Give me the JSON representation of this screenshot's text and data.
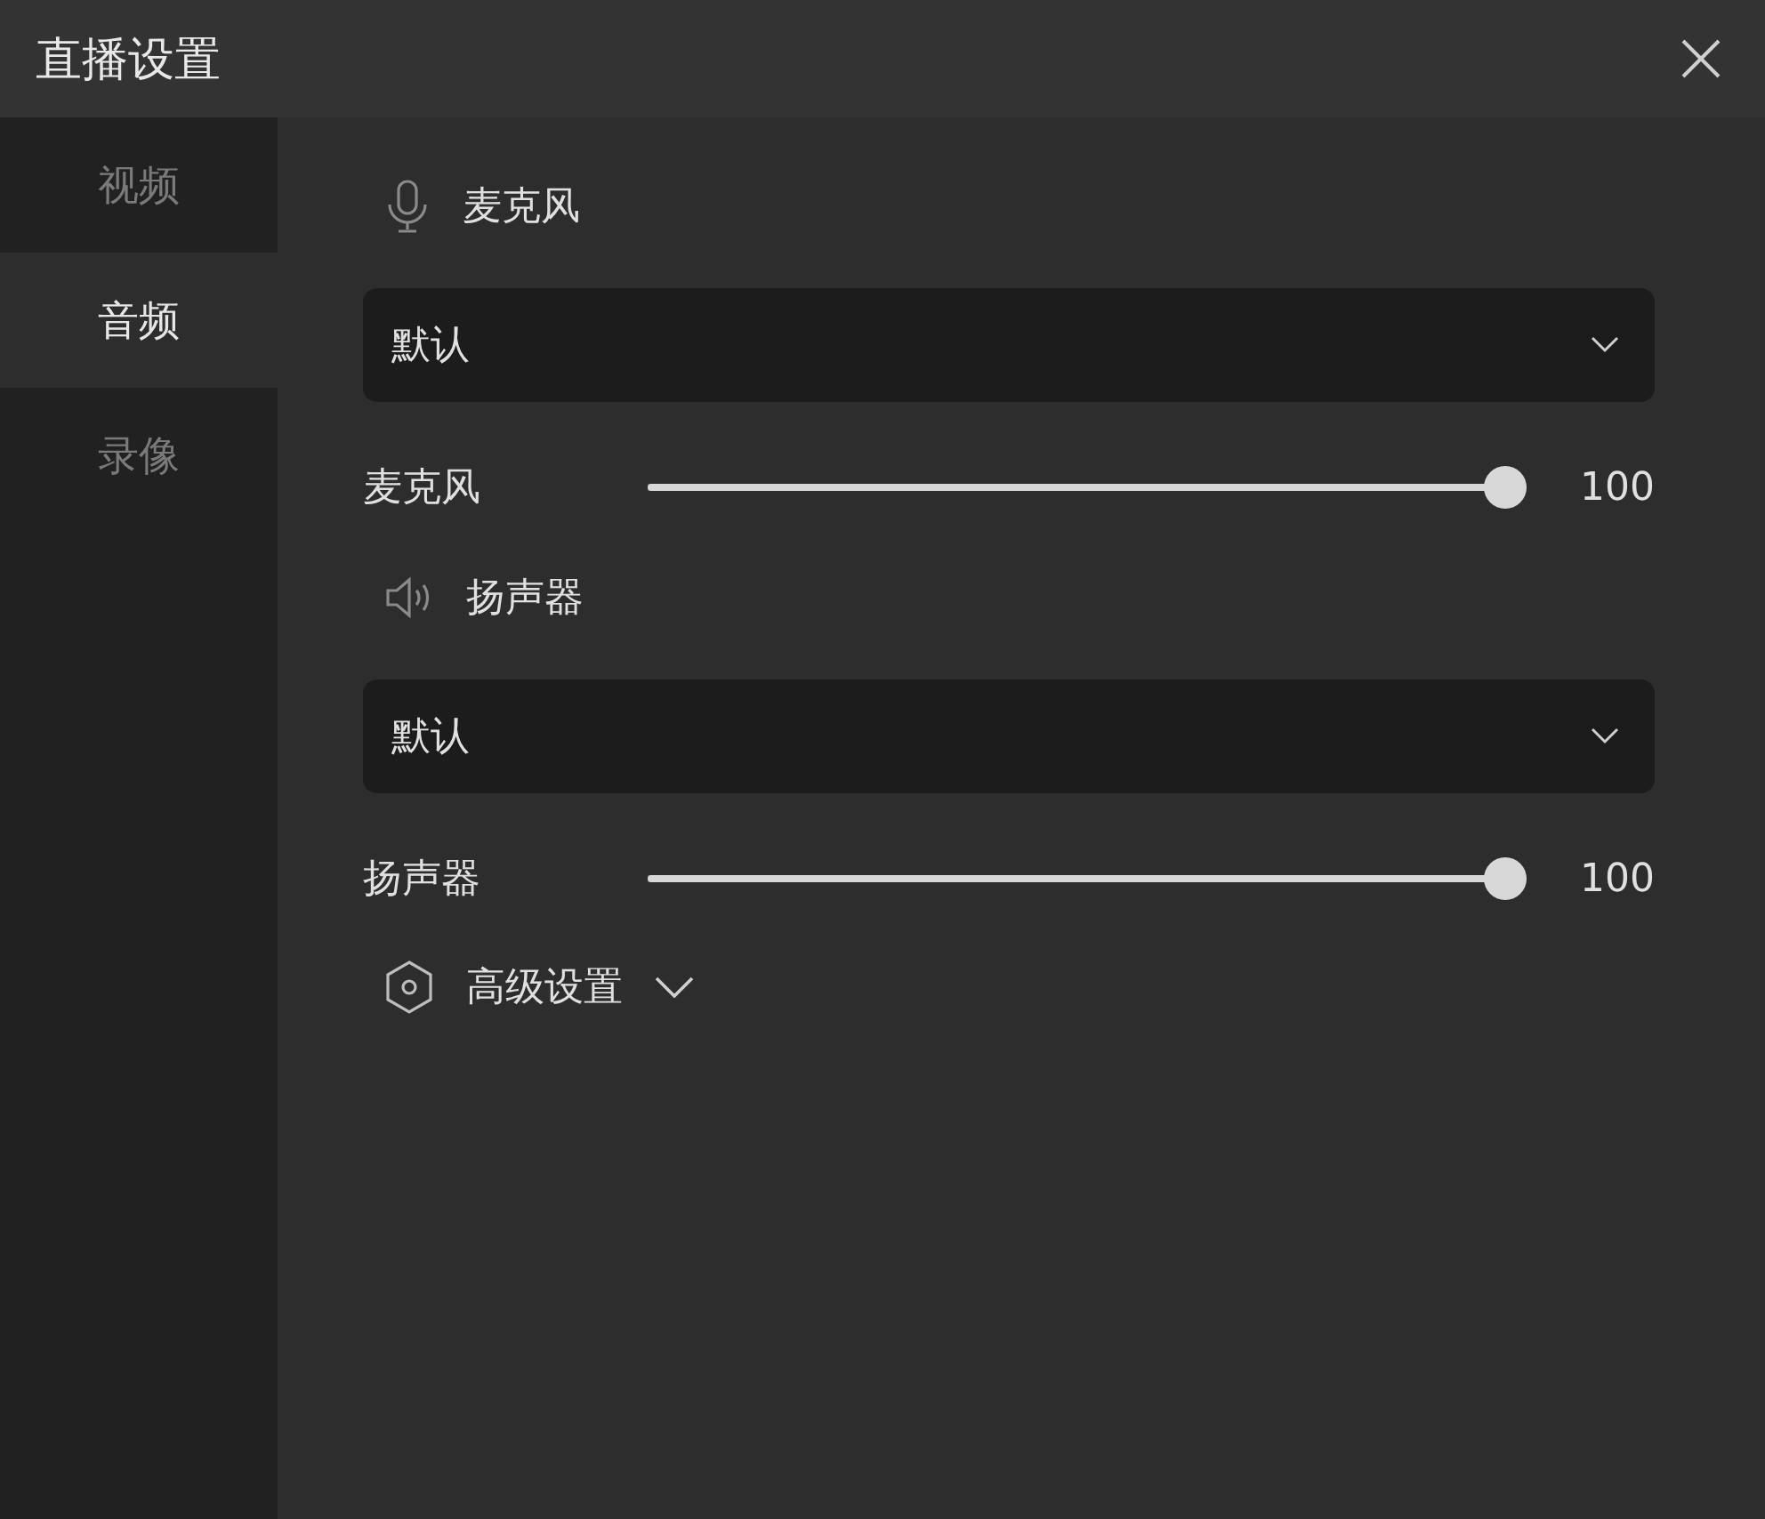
{
  "window": {
    "title": "直播设置"
  },
  "tabs": [
    {
      "label": "视频",
      "selected": false
    },
    {
      "label": "音频",
      "selected": true
    },
    {
      "label": "录像",
      "selected": false
    }
  ],
  "devices": [
    {
      "kind": "microphone",
      "heading": "麦克风",
      "select": {
        "value": "默认"
      },
      "volume": {
        "label": "麦克风",
        "level": 1,
        "reading": "100"
      }
    },
    {
      "kind": "speaker",
      "heading": "扬声器",
      "select": {
        "value": "默认"
      },
      "volume": {
        "label": "扬声器",
        "level": 1,
        "reading": "100"
      }
    }
  ],
  "advanced": {
    "label": "高级设置",
    "expanded": false
  }
}
